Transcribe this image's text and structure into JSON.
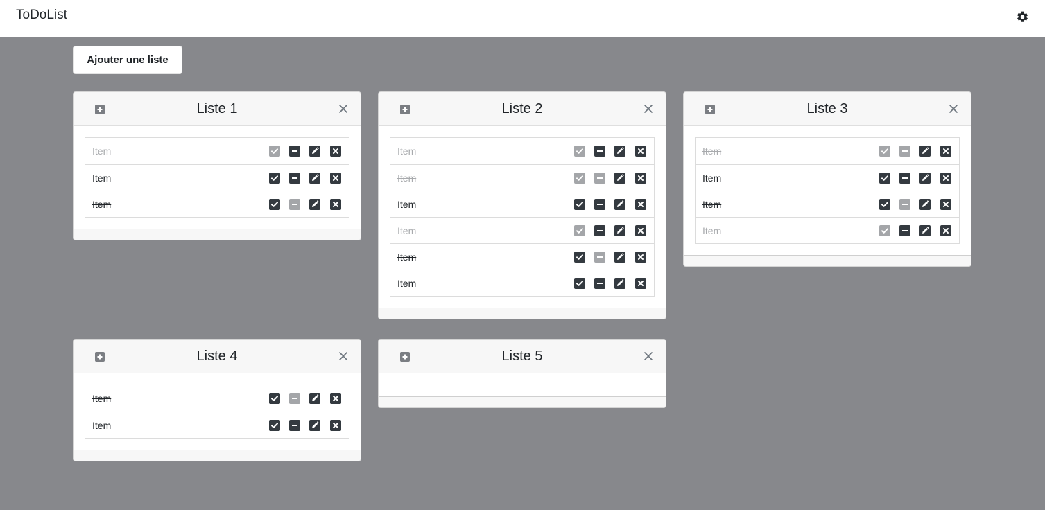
{
  "app": {
    "title": "ToDoList"
  },
  "toolbar": {
    "add_list_label": "Ajouter une liste"
  },
  "icons": {
    "settings": "gear-icon",
    "add_item": "plus-square-icon",
    "close_list": "close-icon",
    "check": "check-icon",
    "minus": "minus-icon",
    "edit": "pencil-icon",
    "delete": "x-icon"
  },
  "colors": {
    "background": "#87888c",
    "button_active": "#343a40",
    "button_inactive": "#a4a6a9",
    "text_muted": "#a8aaad"
  },
  "lists": [
    {
      "title": "Liste 1",
      "items": [
        {
          "text": "Item",
          "checked": true,
          "struck": false,
          "muted": true
        },
        {
          "text": "Item",
          "checked": false,
          "struck": false,
          "muted": false
        },
        {
          "text": "Item",
          "checked": false,
          "struck": true,
          "muted": false
        }
      ]
    },
    {
      "title": "Liste 2",
      "items": [
        {
          "text": "Item",
          "checked": true,
          "struck": false,
          "muted": true
        },
        {
          "text": "Item",
          "checked": true,
          "struck": true,
          "muted": true
        },
        {
          "text": "Item",
          "checked": false,
          "struck": false,
          "muted": false
        },
        {
          "text": "Item",
          "checked": true,
          "struck": false,
          "muted": true
        },
        {
          "text": "Item",
          "checked": false,
          "struck": true,
          "muted": false
        },
        {
          "text": "Item",
          "checked": false,
          "struck": false,
          "muted": false
        }
      ]
    },
    {
      "title": "Liste 3",
      "items": [
        {
          "text": "Item",
          "checked": true,
          "struck": true,
          "muted": true
        },
        {
          "text": "Item",
          "checked": false,
          "struck": false,
          "muted": false
        },
        {
          "text": "Item",
          "checked": false,
          "struck": true,
          "muted": false
        },
        {
          "text": "Item",
          "checked": true,
          "struck": false,
          "muted": true
        }
      ]
    },
    {
      "title": "Liste 4",
      "items": [
        {
          "text": "Item",
          "checked": false,
          "struck": true,
          "muted": false
        },
        {
          "text": "Item",
          "checked": false,
          "struck": false,
          "muted": false
        }
      ]
    },
    {
      "title": "Liste 5",
      "items": []
    }
  ]
}
